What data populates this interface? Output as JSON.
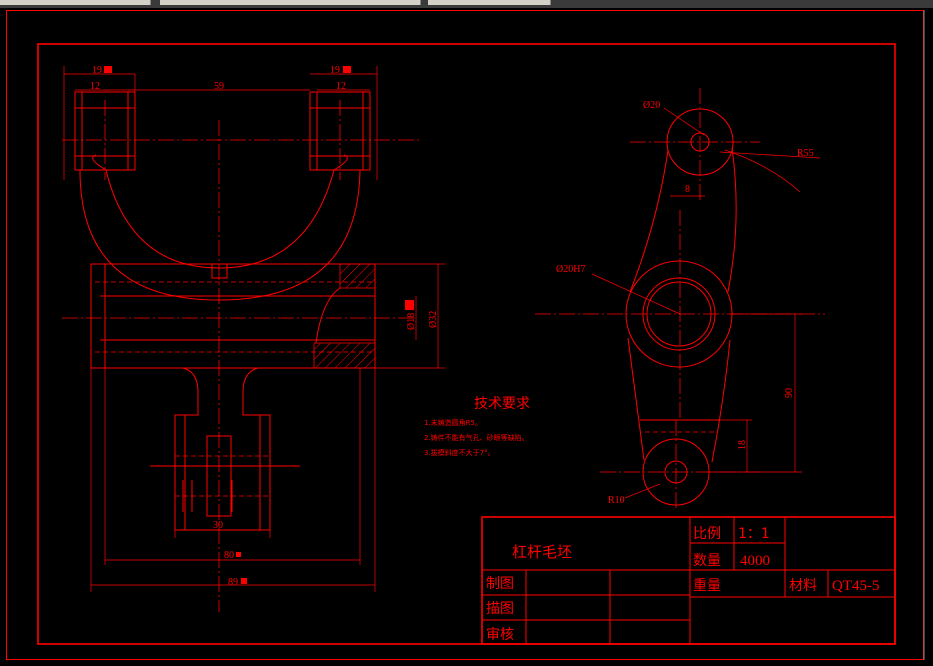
{
  "drawing": {
    "front_view": {
      "dim_19_left": "19",
      "dim_12_left": "12",
      "dim_59": "59",
      "dim_19_right": "19",
      "dim_12_right": "12",
      "dim_phi18": "Ø18",
      "dim_phi32": "Ø32",
      "dim_30": "30",
      "dim_80": "80",
      "dim_89": "89"
    },
    "side_view": {
      "dim_phi20": "Ø20",
      "dim_r55": "R55",
      "dim_8": "8",
      "dim_phi20h7": "Ø20H7",
      "dim_90": "90",
      "dim_18": "18",
      "dim_r10": "R10"
    },
    "tech_requirements": {
      "heading": "技术要求",
      "items": [
        "1.未铸造圆角R5。",
        "2.铸件不能有气孔、砂眼等缺陷。",
        "3.拔模斜度不大于7°。"
      ]
    },
    "title_block": {
      "part_name": "杠杆毛坯",
      "scale_label": "比例",
      "scale_value": "1：1",
      "quantity_label": "数量",
      "quantity_value": "4000",
      "weight_label": "重量",
      "material_label": "材料",
      "material_value": "QT45-5",
      "drawn_label": "制图",
      "traced_label": "描图",
      "checked_label": "审核"
    }
  },
  "colors": {
    "line": "#ff0000",
    "background": "#000000"
  }
}
